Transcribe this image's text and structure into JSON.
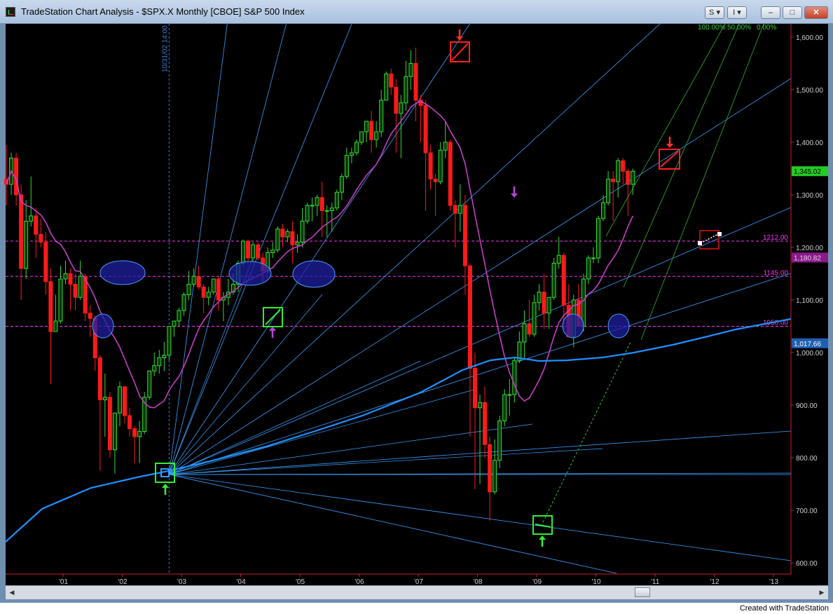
{
  "window": {
    "title": "TradeStation Chart Analysis - $SPX.X Monthly [CBOE] S&P 500 Index",
    "s_button": "S",
    "i_button": "I",
    "minimize": "–",
    "maximize": "□",
    "close": "✕"
  },
  "credit": "Created with TradeStation",
  "chart_data": {
    "type": "candlestick",
    "title": "$SPX.X Monthly [CBOE] S&P 500 Index",
    "x_axis": {
      "labels": [
        "'01",
        "'02",
        "'03",
        "'04",
        "'05",
        "'06",
        "'07",
        "'08",
        "'09",
        "'10",
        "'11",
        "'12",
        "'13"
      ]
    },
    "y_axis": {
      "labels": [
        "600.00",
        "700.00",
        "800.00",
        "900.00",
        "1,000.00",
        "1,100.00",
        "1,200.00",
        "1,300.00",
        "1,400.00",
        "1,500.00",
        "1,600.00"
      ],
      "range": [
        570,
        1640
      ]
    },
    "last_price_label": "1,345.02",
    "ma_short_label": "1,180.82",
    "ma_long_label": "1,017.66",
    "horizontal_levels": [
      {
        "label": "1212.00",
        "value": 1212
      },
      {
        "label": "1145.00",
        "value": 1145
      },
      {
        "label": "1050.00",
        "value": 1050
      }
    ],
    "vertical_marker_label": "10/31/02 14:00",
    "fib_channel_labels": [
      "100.00%",
      "50.00%",
      "0.00%"
    ],
    "colors": {
      "background": "#000000",
      "up_candle": "#33dd33",
      "down_candle": "#ff1a1a",
      "ma_short": "#c43fc4",
      "ma_long": "#1e90ff",
      "gann_fan": "#3aa0ff",
      "fib_lines": "#2f9f2f",
      "level_lines": "#ff33ff"
    },
    "candles": [
      [
        1330,
        1395,
        1280,
        1320
      ],
      [
        1320,
        1380,
        1300,
        1370
      ],
      [
        1370,
        1380,
        1280,
        1300
      ],
      [
        1300,
        1320,
        1100,
        1160
      ],
      [
        1160,
        1290,
        1140,
        1250
      ],
      [
        1250,
        1335,
        1240,
        1260
      ],
      [
        1260,
        1275,
        1180,
        1225
      ],
      [
        1225,
        1255,
        1200,
        1210
      ],
      [
        1210,
        1230,
        1110,
        1135
      ],
      [
        1135,
        1160,
        940,
        1040
      ],
      [
        1040,
        1110,
        1040,
        1060
      ],
      [
        1060,
        1165,
        1055,
        1140
      ],
      [
        1140,
        1175,
        1130,
        1150
      ],
      [
        1150,
        1160,
        1080,
        1130
      ],
      [
        1130,
        1150,
        1080,
        1105
      ],
      [
        1105,
        1175,
        1100,
        1145
      ],
      [
        1145,
        1150,
        1060,
        1075
      ],
      [
        1075,
        1090,
        1030,
        1065
      ],
      [
        1065,
        1070,
        965,
        990
      ],
      [
        990,
        995,
        775,
        910
      ],
      [
        910,
        960,
        840,
        915
      ],
      [
        915,
        925,
        800,
        815
      ],
      [
        815,
        835,
        770,
        885
      ],
      [
        885,
        945,
        860,
        935
      ],
      [
        935,
        935,
        865,
        880
      ],
      [
        880,
        895,
        840,
        855
      ],
      [
        855,
        860,
        790,
        840
      ],
      [
        840,
        870,
        790,
        850
      ],
      [
        850,
        925,
        845,
        915
      ],
      [
        915,
        960,
        910,
        965
      ],
      [
        965,
        1000,
        955,
        975
      ],
      [
        975,
        1005,
        960,
        990
      ],
      [
        990,
        1020,
        965,
        995
      ],
      [
        995,
        1045,
        985,
        1050
      ],
      [
        1050,
        1060,
        1030,
        1060
      ],
      [
        1060,
        1085,
        1050,
        1080
      ],
      [
        1080,
        1115,
        1070,
        1110
      ],
      [
        1110,
        1155,
        1100,
        1130
      ],
      [
        1130,
        1160,
        1125,
        1145
      ],
      [
        1145,
        1165,
        1120,
        1125
      ],
      [
        1125,
        1130,
        1075,
        1105
      ],
      [
        1105,
        1125,
        1090,
        1115
      ],
      [
        1115,
        1140,
        1110,
        1140
      ],
      [
        1140,
        1145,
        1080,
        1100
      ],
      [
        1100,
        1115,
        1060,
        1105
      ],
      [
        1105,
        1140,
        1090,
        1115
      ],
      [
        1115,
        1150,
        1110,
        1130
      ],
      [
        1130,
        1175,
        1115,
        1170
      ],
      [
        1170,
        1215,
        1165,
        1212
      ],
      [
        1212,
        1215,
        1170,
        1180
      ],
      [
        1180,
        1210,
        1170,
        1205
      ],
      [
        1205,
        1210,
        1175,
        1180
      ],
      [
        1180,
        1190,
        1135,
        1155
      ],
      [
        1155,
        1200,
        1150,
        1190
      ],
      [
        1190,
        1210,
        1180,
        1195
      ],
      [
        1195,
        1240,
        1190,
        1235
      ],
      [
        1235,
        1245,
        1200,
        1220
      ],
      [
        1220,
        1235,
        1210,
        1230
      ],
      [
        1230,
        1250,
        1170,
        1205
      ],
      [
        1205,
        1225,
        1190,
        1210
      ],
      [
        1210,
        1275,
        1200,
        1250
      ],
      [
        1250,
        1285,
        1245,
        1280
      ],
      [
        1280,
        1295,
        1250,
        1280
      ],
      [
        1280,
        1300,
        1260,
        1295
      ],
      [
        1295,
        1325,
        1220,
        1270
      ],
      [
        1270,
        1280,
        1220,
        1270
      ],
      [
        1270,
        1285,
        1230,
        1275
      ],
      [
        1275,
        1310,
        1270,
        1305
      ],
      [
        1305,
        1340,
        1290,
        1335
      ],
      [
        1335,
        1390,
        1330,
        1375
      ],
      [
        1375,
        1390,
        1360,
        1380
      ],
      [
        1380,
        1405,
        1375,
        1400
      ],
      [
        1400,
        1420,
        1395,
        1420
      ],
      [
        1420,
        1440,
        1400,
        1440
      ],
      [
        1440,
        1460,
        1380,
        1405
      ],
      [
        1405,
        1440,
        1390,
        1420
      ],
      [
        1420,
        1500,
        1410,
        1480
      ],
      [
        1480,
        1535,
        1480,
        1530
      ],
      [
        1530,
        1540,
        1490,
        1505
      ],
      [
        1505,
        1520,
        1380,
        1455
      ],
      [
        1455,
        1490,
        1370,
        1475
      ],
      [
        1475,
        1555,
        1460,
        1525
      ],
      [
        1525,
        1575,
        1500,
        1550
      ],
      [
        1550,
        1580,
        1440,
        1480
      ],
      [
        1480,
        1490,
        1400,
        1470
      ],
      [
        1470,
        1480,
        1270,
        1380
      ],
      [
        1380,
        1395,
        1310,
        1330
      ],
      [
        1330,
        1340,
        1260,
        1325
      ],
      [
        1325,
        1400,
        1320,
        1385
      ],
      [
        1385,
        1440,
        1370,
        1400
      ],
      [
        1400,
        1405,
        1270,
        1280
      ],
      [
        1280,
        1290,
        1200,
        1265
      ],
      [
        1265,
        1320,
        1230,
        1280
      ],
      [
        1280,
        1300,
        1110,
        1165
      ],
      [
        1165,
        1170,
        840,
        970
      ],
      [
        970,
        1000,
        740,
        895
      ],
      [
        895,
        920,
        750,
        905
      ],
      [
        905,
        935,
        800,
        825
      ],
      [
        825,
        840,
        680,
        735
      ],
      [
        735,
        835,
        730,
        795
      ],
      [
        795,
        880,
        780,
        870
      ],
      [
        870,
        930,
        860,
        920
      ],
      [
        920,
        950,
        880,
        920
      ],
      [
        920,
        990,
        905,
        985
      ],
      [
        985,
        1040,
        980,
        1020
      ],
      [
        1020,
        1080,
        990,
        1055
      ],
      [
        1055,
        1100,
        1030,
        1035
      ],
      [
        1035,
        1110,
        1030,
        1095
      ],
      [
        1095,
        1130,
        1080,
        1115
      ],
      [
        1115,
        1150,
        1045,
        1075
      ],
      [
        1075,
        1105,
        1045,
        1105
      ],
      [
        1105,
        1180,
        1100,
        1170
      ],
      [
        1170,
        1220,
        1160,
        1185
      ],
      [
        1185,
        1190,
        1040,
        1090
      ],
      [
        1090,
        1130,
        1030,
        1030
      ],
      [
        1030,
        1110,
        1010,
        1100
      ],
      [
        1100,
        1130,
        1050,
        1050
      ],
      [
        1050,
        1150,
        1040,
        1140
      ],
      [
        1140,
        1185,
        1130,
        1180
      ],
      [
        1180,
        1200,
        1170,
        1180
      ],
      [
        1180,
        1260,
        1170,
        1255
      ],
      [
        1255,
        1300,
        1250,
        1285
      ],
      [
        1285,
        1345,
        1280,
        1330
      ],
      [
        1330,
        1345,
        1250,
        1325
      ],
      [
        1325,
        1370,
        1295,
        1365
      ],
      [
        1365,
        1370,
        1320,
        1345
      ],
      [
        1345,
        1350,
        1260,
        1320
      ],
      [
        1320,
        1350,
        1300,
        1345
      ]
    ]
  }
}
